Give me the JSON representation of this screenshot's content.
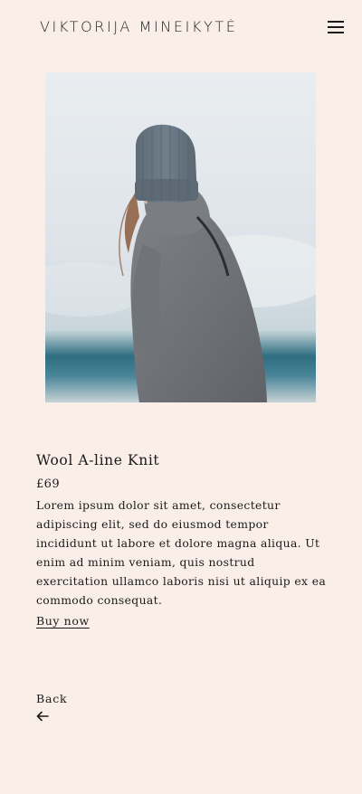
{
  "header": {
    "brand": "VIKTORIJA MINEIKYTĖ",
    "menu_icon": "hamburger-menu-icon"
  },
  "product": {
    "image_alt": "Woman wearing grey wool knit sweater and beanie",
    "title": "Wool A-line Knit",
    "price": "£69",
    "description": "Lorem ipsum dolor sit amet, consectetur adipiscing elit, sed do eiusmod tempor incididunt ut labore et dolore magna aliqua. Ut enim ad minim veniam, quis nostrud exercitation ullamco laboris nisi ut aliquip ex ea commodo consequat.",
    "buy_label": "Buy now"
  },
  "nav": {
    "back_label": "Back",
    "back_icon": "arrow-left-icon"
  },
  "colors": {
    "background": "#f9efe8",
    "text": "#1a1a1a"
  }
}
